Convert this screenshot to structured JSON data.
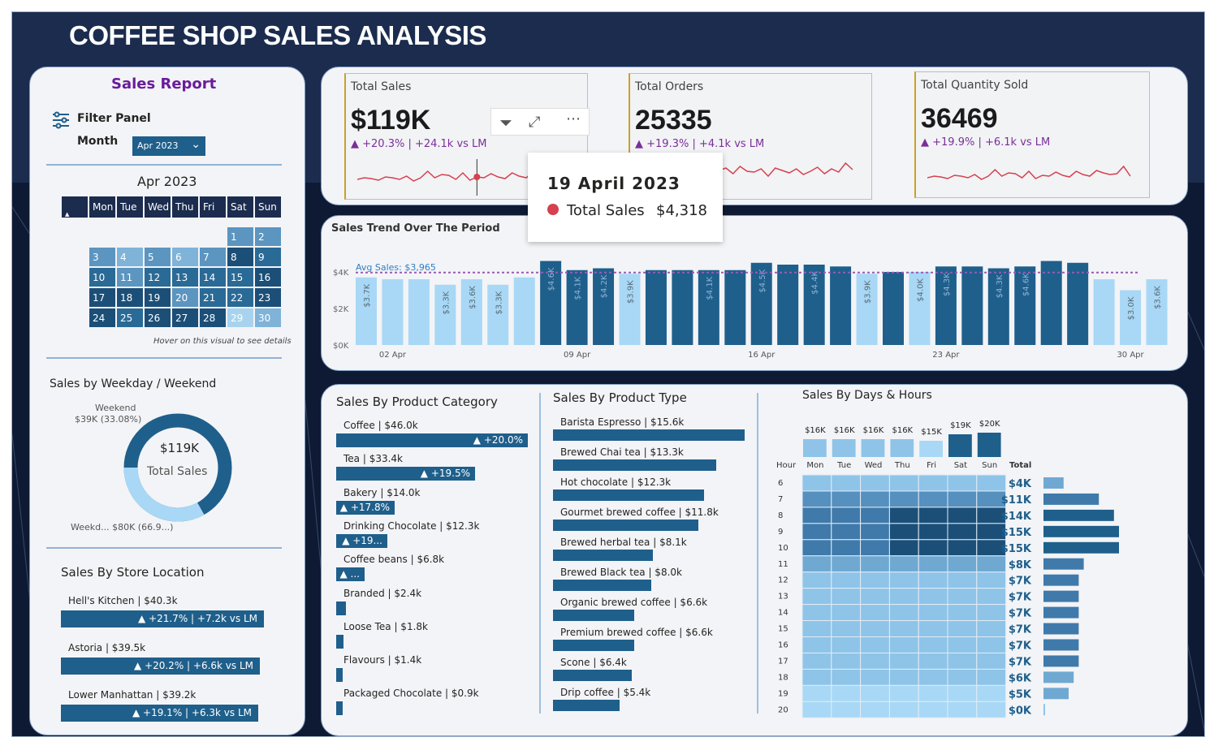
{
  "title": "COFFEE SHOP SALES ANALYSIS",
  "sidebar": {
    "heading": "Sales Report",
    "filter_label": "Filter Panel",
    "month_label": "Month",
    "month_value": "Apr 2023",
    "calendar_title": "Apr 2023",
    "calendar_days": [
      "Mon",
      "Tue",
      "Wed",
      "Thu",
      "Fri",
      "Sat",
      "Sun"
    ],
    "calendar_hint": "Hover on this visual to see details",
    "weekday_title": "Sales by Weekday / Weekend",
    "weekend_label": "Weekend",
    "weekend_value": "$39K (33.08%)",
    "weekday_label": "Weekd... $80K (66.9...)",
    "donut_value": "$119K",
    "donut_caption": "Total Sales",
    "weekend_fraction": 0.3308,
    "store_title": "Sales By Store Location",
    "stores": [
      {
        "name": "Hell's Kitchen | $40.3k",
        "delta": "▲ +21.7% | +7.2k vs LM",
        "value": 40.3
      },
      {
        "name": "Astoria | $39.5k",
        "delta": "▲ +20.2% | +6.6k vs LM",
        "value": 39.5
      },
      {
        "name": "Lower Manhattan | $39.2k",
        "delta": "▲ +19.1% | +6.3k vs LM",
        "value": 39.2
      }
    ]
  },
  "kpis": [
    {
      "title": "Total Sales",
      "value": "$119K",
      "delta": "▲ +20.3% | +24.1k vs LM"
    },
    {
      "title": "Total Orders",
      "value": "25335",
      "delta": "▲ +19.3% | +4.1k vs LM"
    },
    {
      "title": "Total Quantity Sold",
      "value": "36469",
      "delta": "▲ +19.9% | +6.1k vs LM"
    }
  ],
  "tooltip": {
    "date": "19 April 2023",
    "label": "Total Sales",
    "value": "$4,318"
  },
  "colors": {
    "dark": "#1f5f8b",
    "light": "#a8d8f5",
    "line": "#d6404f",
    "avg": "#9b59b6",
    "accent": "#6a1b9a"
  },
  "chart_data": [
    {
      "type": "bar",
      "title": "Sales Trend Over The Period",
      "avg_label": "Avg Sales: $3,965",
      "avg": 3965,
      "ylim": [
        0,
        4800
      ],
      "yticks": [
        "$0K",
        "$2K",
        "$4K"
      ],
      "xticks": [
        "02 Apr",
        "09 Apr",
        "16 Apr",
        "23 Apr",
        "30 Apr"
      ],
      "values": [
        3.7,
        3.6,
        3.6,
        3.3,
        3.6,
        3.3,
        3.7,
        4.6,
        4.1,
        4.2,
        3.9,
        4.1,
        4.1,
        4.1,
        4.1,
        4.5,
        4.4,
        4.4,
        4.3,
        3.9,
        4.0,
        4.0,
        4.3,
        4.3,
        4.2,
        4.3,
        4.6,
        4.5,
        3.6,
        3.0,
        3.6
      ],
      "labels": [
        "$3.7K",
        "",
        "",
        "$3.3K",
        "$3.6K",
        "$3.3K",
        "",
        "$4.6K",
        "$4.1K",
        "$4.2K",
        "$3.9K",
        "",
        "",
        "$4.1K",
        "",
        "$4.5K",
        "",
        "$4.4K",
        "",
        "$3.9K",
        "",
        "$4.0K",
        "$4.3K",
        "",
        "$4.3K",
        "$4.6K",
        "",
        "",
        "",
        "$3.0K",
        "$3.6K"
      ]
    },
    {
      "type": "bar",
      "title": "Sales By Product Category",
      "items": [
        {
          "name": "Coffee | $46.0k",
          "value": 46.0,
          "delta": "▲ +20.0%"
        },
        {
          "name": "Tea | $33.4k",
          "value": 33.4,
          "delta": "▲ +19.5%"
        },
        {
          "name": "Bakery | $14.0k",
          "value": 14.0,
          "delta": "▲ +17.8%"
        },
        {
          "name": "Drinking Chocolate | $12.3k",
          "value": 12.3,
          "delta": "▲ +19..."
        },
        {
          "name": "Coffee beans | $6.8k",
          "value": 6.8,
          "delta": "▲ ..."
        },
        {
          "name": "Branded | $2.4k",
          "value": 2.4,
          "delta": ""
        },
        {
          "name": "Loose Tea | $1.8k",
          "value": 1.8,
          "delta": ""
        },
        {
          "name": "Flavours | $1.4k",
          "value": 1.4,
          "delta": ""
        },
        {
          "name": "Packaged Chocolate | $0.9k",
          "value": 0.9,
          "delta": ""
        }
      ]
    },
    {
      "type": "bar",
      "title": "Sales By Product Type",
      "items": [
        {
          "name": "Barista Espresso | $15.6k",
          "value": 15.6
        },
        {
          "name": "Brewed Chai tea | $13.3k",
          "value": 13.3
        },
        {
          "name": "Hot chocolate | $12.3k",
          "value": 12.3
        },
        {
          "name": "Gourmet brewed coffee | $11.8k",
          "value": 11.8
        },
        {
          "name": "Brewed herbal tea | $8.1k",
          "value": 8.1
        },
        {
          "name": "Brewed Black tea | $8.0k",
          "value": 8.0
        },
        {
          "name": "Organic brewed coffee | $6.6k",
          "value": 6.6
        },
        {
          "name": "Premium brewed coffee | $6.6k",
          "value": 6.6
        },
        {
          "name": "Scone | $6.4k",
          "value": 6.4
        },
        {
          "name": "Drip coffee | $5.4k",
          "value": 5.4
        }
      ]
    },
    {
      "type": "heatmap",
      "title": "Sales By Days & Hours",
      "days": [
        "Mon",
        "Tue",
        "Wed",
        "Thu",
        "Fri",
        "Sat",
        "Sun"
      ],
      "day_totals": [
        "$16K",
        "$16K",
        "$16K",
        "$16K",
        "$15K",
        "$19K",
        "$20K"
      ],
      "day_values": [
        16,
        16,
        16,
        16,
        15,
        19,
        20
      ],
      "hour_header": "Hour",
      "total_header": "Total",
      "hours": [
        "6",
        "7",
        "8",
        "9",
        "10",
        "11",
        "12",
        "13",
        "14",
        "15",
        "16",
        "17",
        "18",
        "19",
        "20"
      ],
      "hour_totals": [
        "$4K",
        "$11K",
        "$14K",
        "$15K",
        "$15K",
        "$8K",
        "$7K",
        "$7K",
        "$7K",
        "$7K",
        "$7K",
        "$7K",
        "$6K",
        "$5K",
        "$0K"
      ],
      "hour_values": [
        4,
        11,
        14,
        15,
        15,
        8,
        7,
        7,
        7,
        7,
        7,
        7,
        6,
        5,
        0.2
      ]
    }
  ]
}
